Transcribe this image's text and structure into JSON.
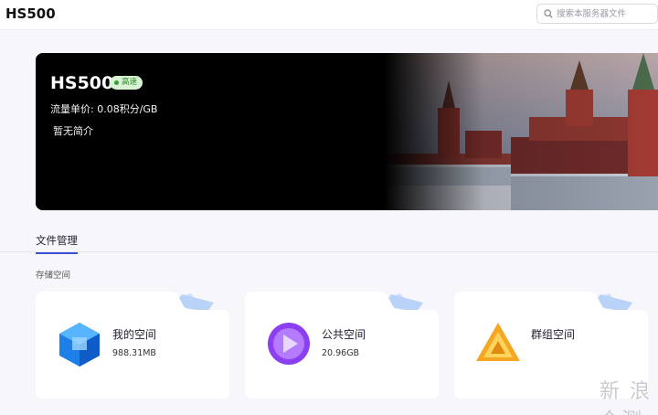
{
  "header": {
    "title": "HS500"
  },
  "search": {
    "placeholder": "搜索本服务器文件",
    "value": ""
  },
  "banner": {
    "name": "HS500",
    "badge": "高速",
    "price": "流量单价: 0.08积分/GB",
    "intro": "暂无简介"
  },
  "tabs": [
    {
      "label": "文件管理",
      "active": true
    }
  ],
  "storage": {
    "label": "存储空间",
    "cards": [
      {
        "name": "我的空间",
        "size": "988.31MB",
        "icon": "blue-cube-icon"
      },
      {
        "name": "公共空间",
        "size": "20.96GB",
        "icon": "purple-sphere-icon"
      },
      {
        "name": "群组空间",
        "size": "",
        "icon": "orange-triangle-icon"
      }
    ]
  },
  "watermark": {
    "text": "新 浪 众测"
  },
  "colors": {
    "accent": "#3b4fd1",
    "badge_bg": "#d8f3d3",
    "badge_text": "#2c8a2c"
  }
}
